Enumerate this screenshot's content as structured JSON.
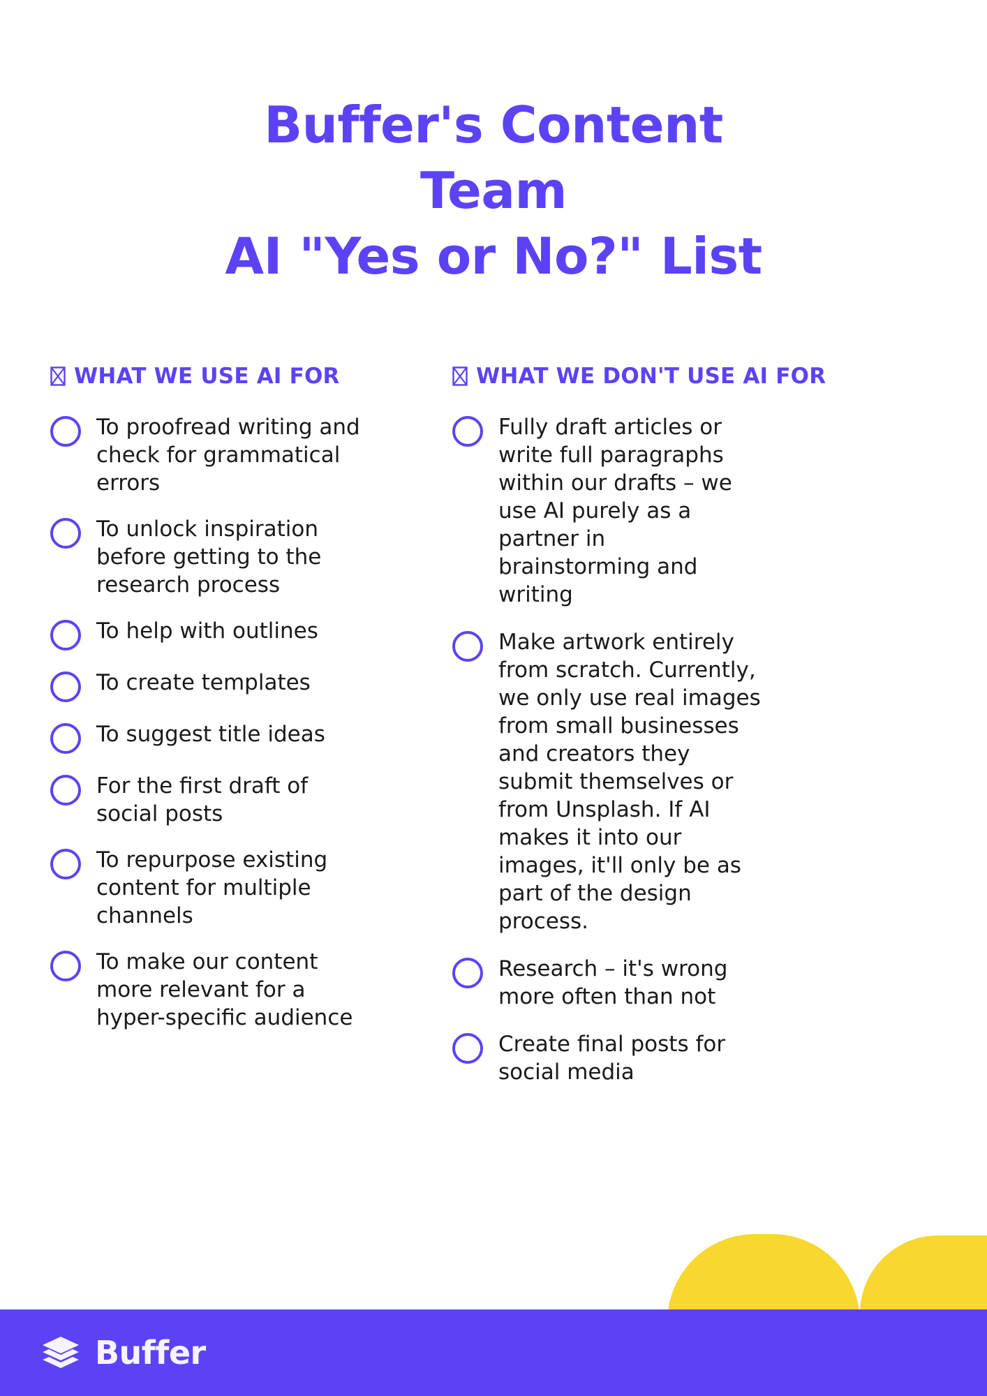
{
  "colors": {
    "brand_purple": "#5B43F5",
    "accent_yellow": "#F8D72E",
    "body_text": "#1A1A1A",
    "page_background": "#FFFFFF",
    "footer_text": "#F7F4FB"
  },
  "title": {
    "line1": "Buffer's Content",
    "line2": "Team",
    "line3": "AI \"Yes or No?\" List"
  },
  "columns": [
    {
      "id": "use-ai-for",
      "icon": "tofu-box-icon",
      "heading": "WHAT WE USE AI FOR",
      "items": [
        "To proofread writing and check for grammatical errors",
        "To unlock inspiration before getting to the research process",
        "To help with outlines",
        "To create templates",
        "To suggest title ideas",
        "For the first draft of social posts",
        "To repurpose existing content for multiple channels",
        "To make our content more relevant for a hyper-specific audience"
      ]
    },
    {
      "id": "dont-use-ai-for",
      "icon": "tofu-box-icon",
      "heading": "WHAT WE DON'T USE AI FOR",
      "items": [
        "Fully draft articles or write full paragraphs within our drafts – we use AI purely as a partner in brainstorming and writing",
        "Make artwork entirely from scratch. Currently, we only use real images from small businesses and creators they submit themselves or from Unsplash. If AI makes it into our images, it'll only be as part of the design process.",
        "Research – it's wrong more often than not",
        "Create final posts for social media"
      ]
    }
  ],
  "footer": {
    "logo_mark": "buffer-layers-logo-icon",
    "brand_name": "Buffer"
  }
}
